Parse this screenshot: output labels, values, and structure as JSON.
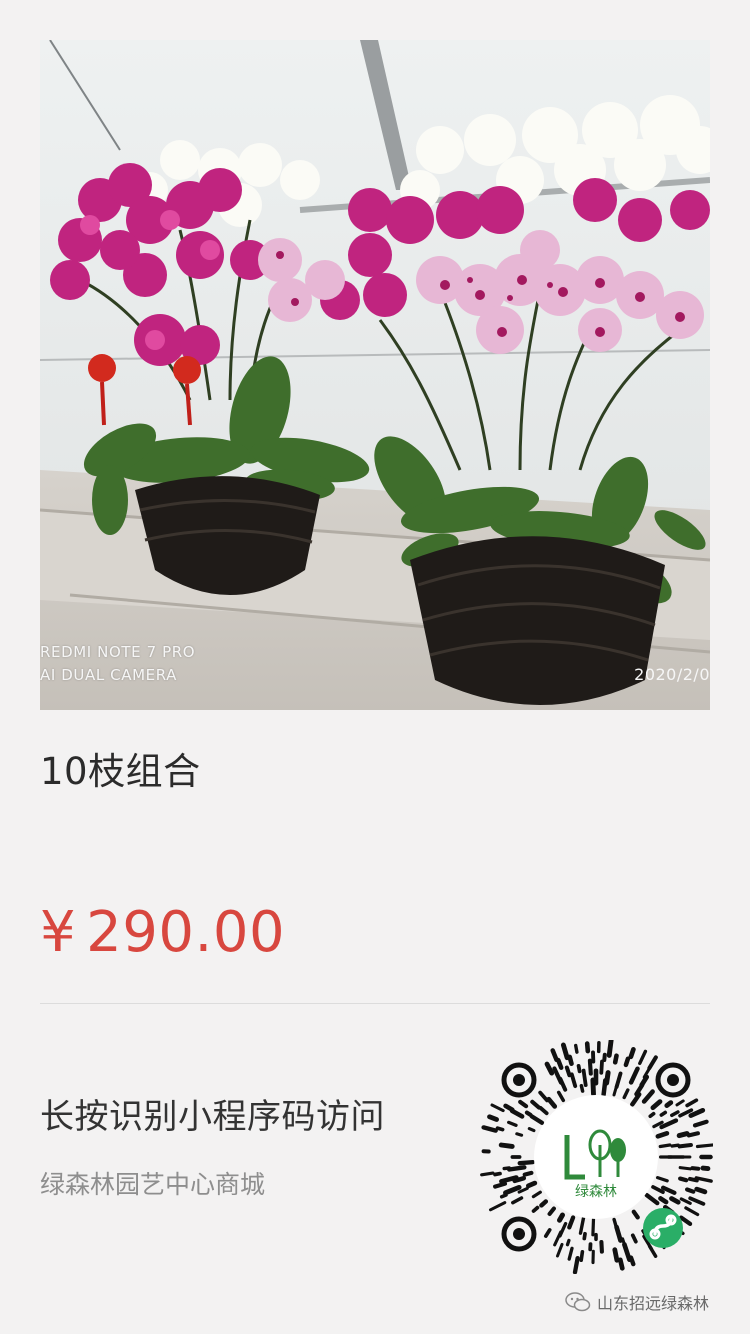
{
  "product": {
    "image_alt": "Potted phalaenopsis orchid arrangements in woven baskets",
    "camera_line1": "REDMI NOTE 7 PRO",
    "camera_line2": "AI DUAL CAMERA",
    "date_stamp": "2020/2/0",
    "title": "10枝组合",
    "currency": "¥",
    "price": "290.00"
  },
  "miniprogram": {
    "cta": "长按识别小程序码访问",
    "shop_name": "绿森林园艺中心商城",
    "qr_logo_text": "绿森林"
  },
  "watermark": {
    "text": "山东招远绿森林"
  },
  "colors": {
    "price": "#d8473f",
    "qr_logo_green": "#2f8a3b",
    "miniprogram_badge": "#2aae67"
  }
}
